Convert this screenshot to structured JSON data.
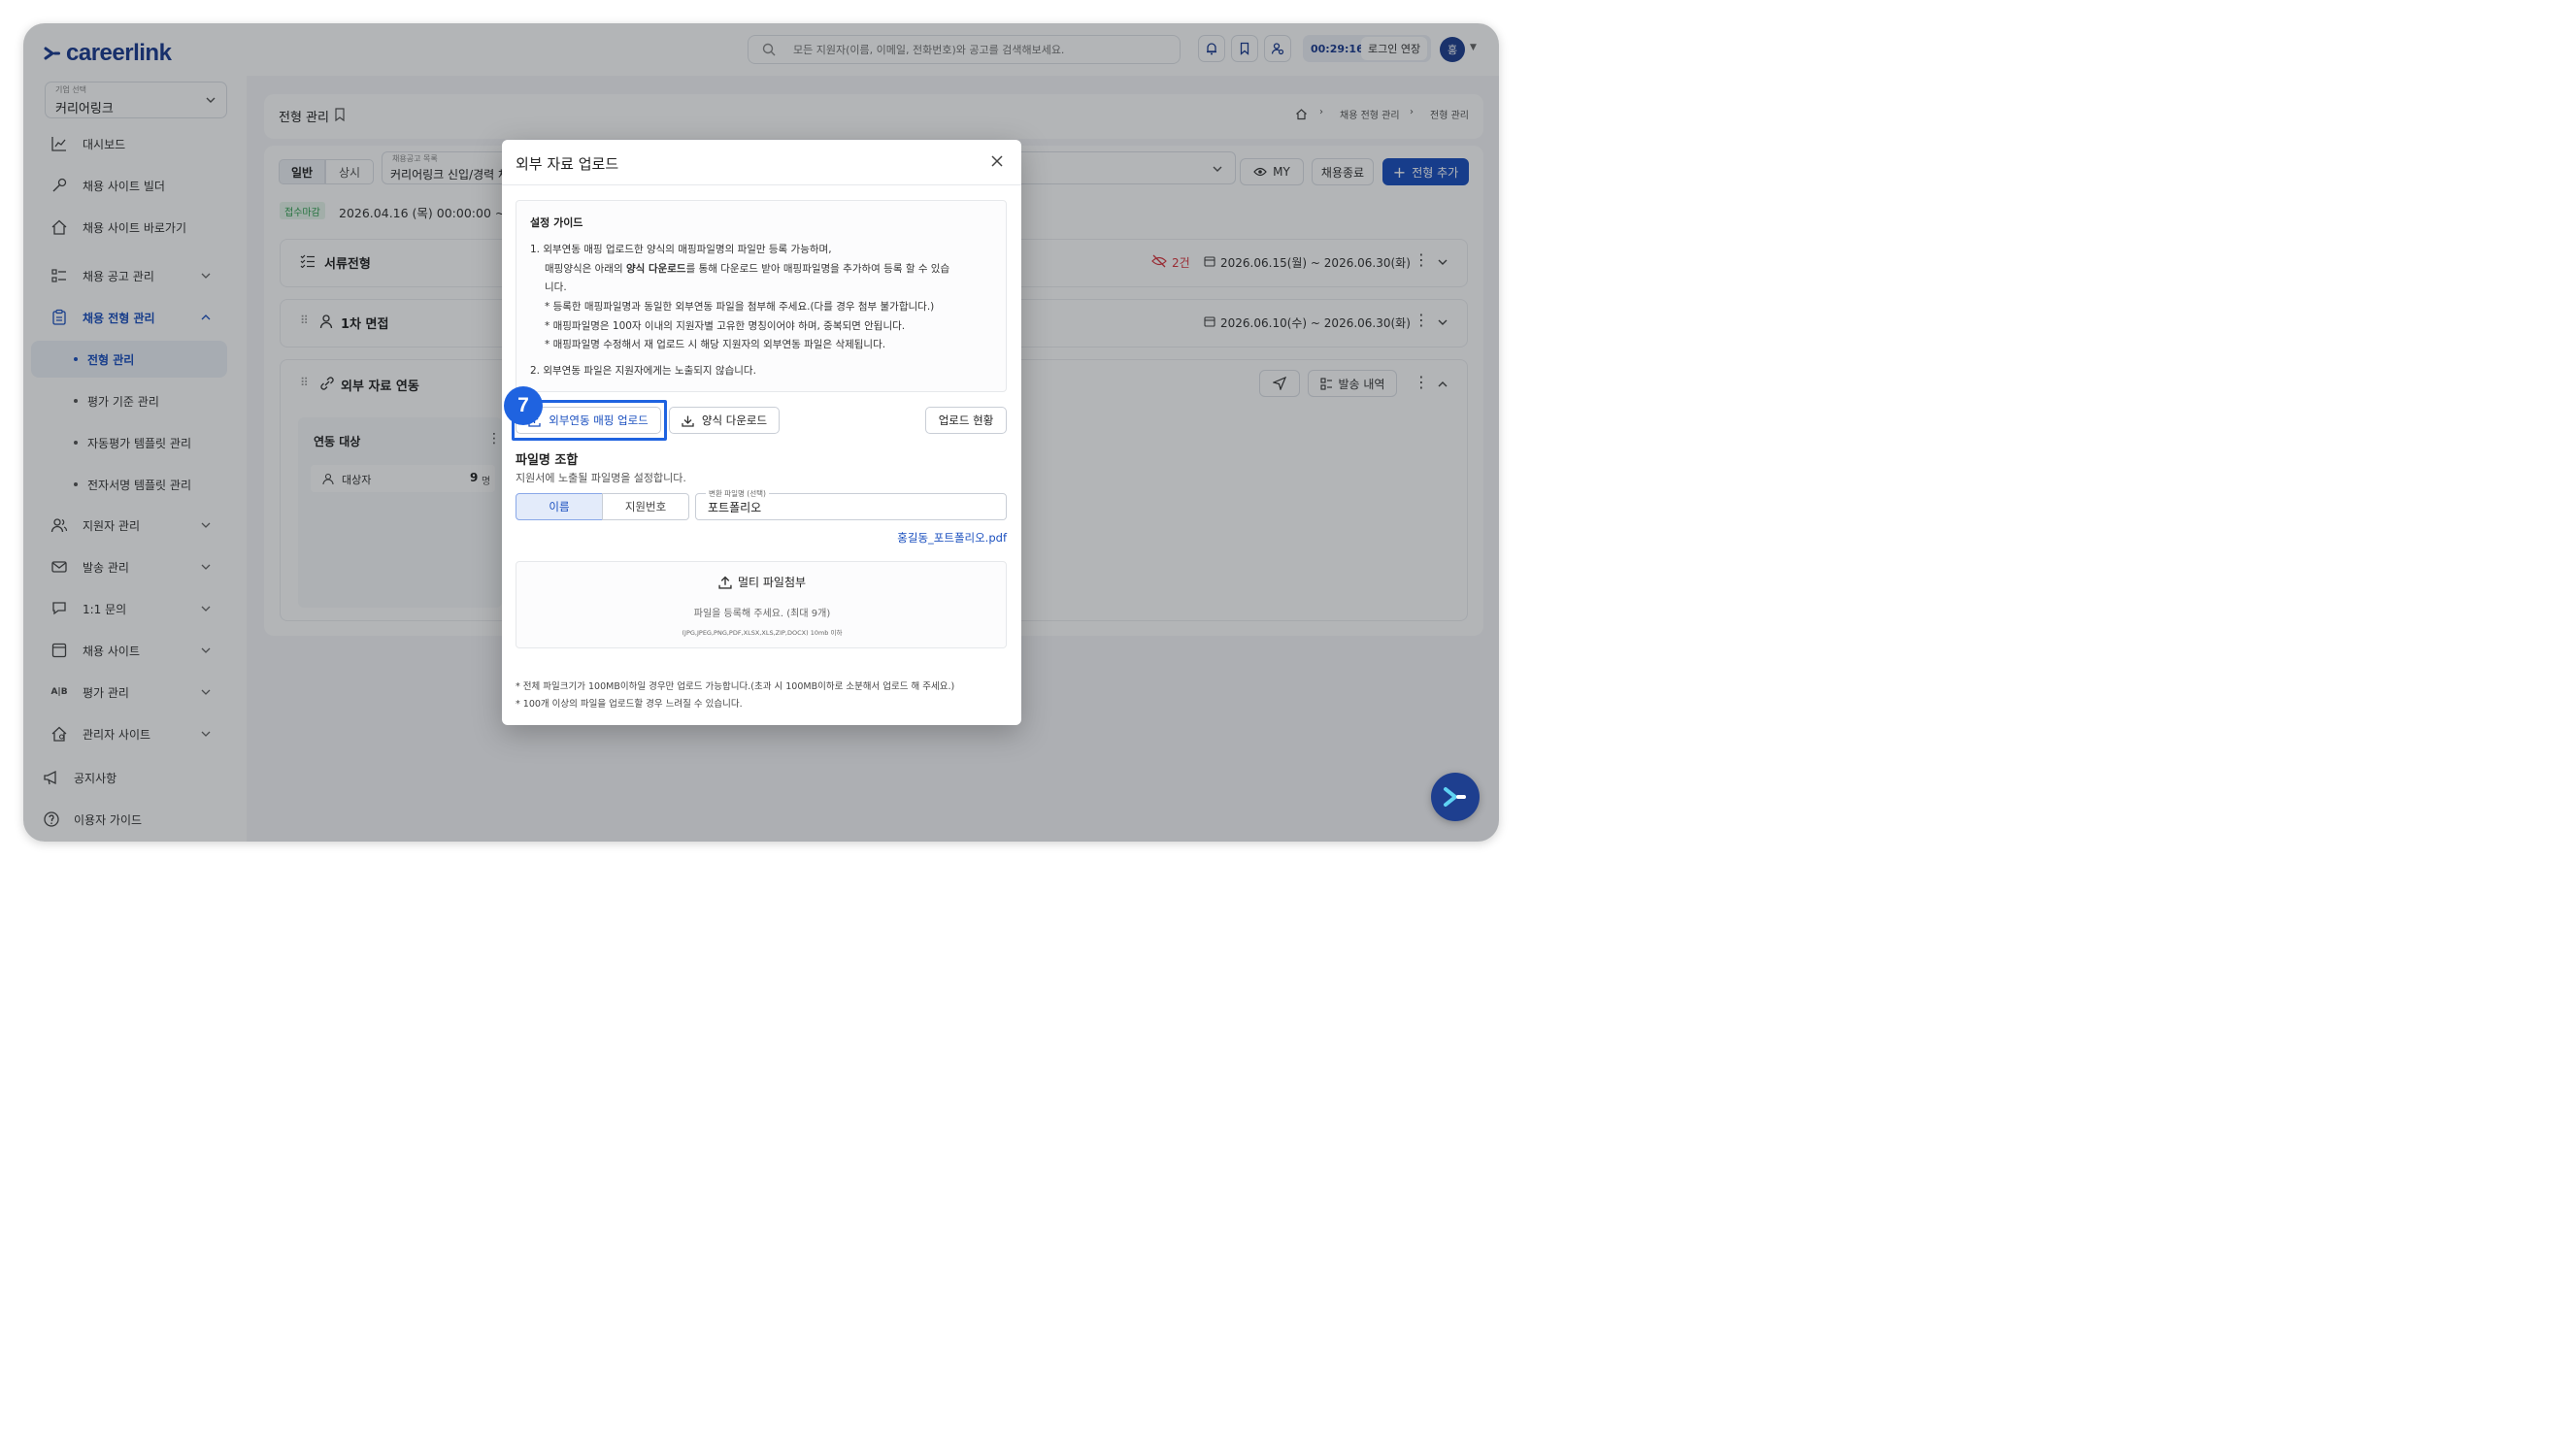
{
  "brand": {
    "name": "careerlink"
  },
  "topbar": {
    "search_placeholder": "모든 지원자(이름, 이메일, 전화번호)와 공고를 검색해보세요.",
    "timer": "00:29:16",
    "extend_label": "로그인 연장",
    "avatar_initial": "홍"
  },
  "sidebar": {
    "company_label": "기업 선택",
    "company_name": "커리어링크",
    "items": [
      {
        "label": "대시보드",
        "icon": "chart-icon"
      },
      {
        "label": "채용 사이트 빌더",
        "icon": "tools-icon"
      },
      {
        "label": "채용 사이트 바로가기",
        "icon": "home-icon"
      },
      {
        "label": "채용 공고 관리",
        "icon": "list-icon"
      },
      {
        "label": "채용 전형 관리",
        "icon": "clipboard-icon"
      },
      {
        "label": "지원자 관리",
        "icon": "users-icon"
      },
      {
        "label": "발송 관리",
        "icon": "mail-icon"
      },
      {
        "label": "1:1 문의",
        "icon": "chat-icon"
      },
      {
        "label": "채용 사이트",
        "icon": "window-icon"
      },
      {
        "label": "평가 관리",
        "icon": "ab-icon"
      },
      {
        "label": "관리자 사이트",
        "icon": "admin-home-icon"
      }
    ],
    "sub_items": [
      "전형 관리",
      "평가 기준 관리",
      "자동평가 템플릿 관리",
      "전자서명 템플릿 관리"
    ],
    "footer": [
      {
        "label": "공지사항",
        "icon": "megaphone-icon"
      },
      {
        "label": "이용자 가이드",
        "icon": "help-icon"
      }
    ]
  },
  "main": {
    "page_title": "전형 관리",
    "breadcrumb": [
      "채용 전형 관리",
      "전형 관리"
    ],
    "seg_general": "일반",
    "seg_always": "상시",
    "posting_label": "채용공고 목록",
    "posting_value": "커리어링크 신입/경력 채",
    "btn_my": "MY",
    "btn_close": "채용종료",
    "btn_add": "전형 추가",
    "status_badge": "접수마감",
    "period": "2026.04.16 (목) 00:00:00 ~ 20",
    "stages": [
      {
        "title": "서류전형",
        "count": "2건",
        "date": "2026.06.15(월) ~ 2026.06.30(화)"
      },
      {
        "title": "1차 면접",
        "date": "2026.06.10(수) ~ 2026.06.30(화)"
      },
      {
        "title": "외부 자료 연동",
        "send_history": "발송 내역"
      }
    ],
    "link_target_title": "연동 대상",
    "link_target_row": "대상자",
    "link_target_count": "9",
    "link_target_unit": "명"
  },
  "modal": {
    "title": "외부 자료 업로드",
    "guide_title": "설정 가이드",
    "guide": {
      "l1": "1.  외부연동 매핑 업로드한 양식의 매핑파일명의 파일만 등록 가능하며,",
      "l2a": "매핑양식은 아래의 ",
      "l2b": "양식 다운로드",
      "l2c": "를 통해 다운로드 받아 매핑파일명을 추가하여 등록 할 수 있습",
      "l3": "니다.",
      "l4": "* 등록한 매핑파일명과 동일한 외부연동 파일을 첨부해 주세요.(다를 경우 첨부 불가합니다.)",
      "l5": "* 매핑파일명은 100자 이내의 지원자별 고유한 명칭이어야 하며, 중복되면 안됩니다.",
      "l6": "* 매핑파일명 수정해서 재 업로드 시 해당 지원자의 외부연동 파일은 삭제됩니다.",
      "l7": "2.  외부연동 파일은 지원자에게는 노출되지 않습니다."
    },
    "step_badge": "7",
    "btn_mapping_upload": "외부연동 매핑 업로드",
    "btn_template_download": "양식 다운로드",
    "btn_upload_status": "업로드 현황",
    "filename_title": "파일명 조합",
    "filename_desc": "지원서에 노출될 파일명을 설정합니다.",
    "toggle_name": "이름",
    "toggle_number": "지원번호",
    "convert_label": "변환 파일명 (선택)",
    "convert_value": "포트폴리오",
    "preview": "홍길동_포트폴리오.pdf",
    "drop_title": "멀티 파일첨부",
    "drop_desc": "파일을 등록해 주세요. (최대 9개)",
    "drop_formats": "(JPG,JPEG,PNG,PDF,XLSX,XLS,ZIP,DOCX) 10mb 이하",
    "note1": "* 전체 파일크기가 100MB이하일 경우만 업로드 가능합니다.(초과 시 100MB이하로 소분해서 업로드 해 주세요.)",
    "note2": "* 100개 이상의 파일을 업로드할 경우 느려질 수 있습니다."
  },
  "colors": {
    "primary": "#1a4fbf",
    "brand": "#1a3a8f",
    "highlight": "#1f63e0",
    "danger": "#d9363e",
    "success": "#2e9e4f"
  }
}
